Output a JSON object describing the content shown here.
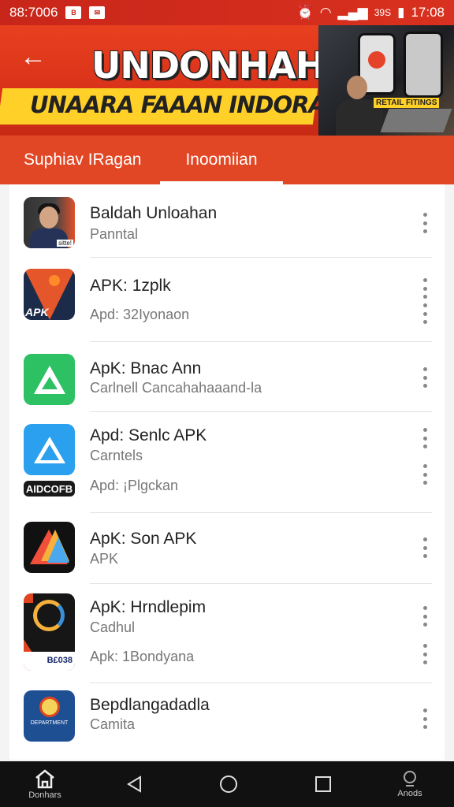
{
  "status_bar": {
    "time_left": "88:7006",
    "battery": "39S",
    "clock": "17:08"
  },
  "header": {
    "back_icon": "back-arrow-icon",
    "banner_title": "UNDONHAHIA",
    "banner_subtitle": "UNAARA FAAAN INDORANEAN!",
    "photo_tag": "RETAIL FITINGS"
  },
  "tabs": [
    {
      "label": "Suphiav IRagan",
      "selected": false
    },
    {
      "label": "Inoomiian",
      "selected": true
    }
  ],
  "apps": [
    {
      "title": "Baldah Unloahan",
      "subtitle": "Panntal",
      "icon": "portrait-icon",
      "icon_tag": "sitte!"
    },
    {
      "title": "APK: 1zplk",
      "subtitle": "Apd: 32Iyonaon",
      "icon": "apk-logo-icon",
      "icon_text": "APK"
    },
    {
      "title": "ApK: Bnac Ann",
      "subtitle": "Carlnell Cancahahaaand-la",
      "icon": "green-triangle-icon"
    },
    {
      "title": "Apd: Senlc APK",
      "subtitle": "Carntels",
      "subtitle2": "Apd: ¡Plgckan",
      "icon": "blue-triangle-icon",
      "pill_label": "AIDCOFB"
    },
    {
      "title": "ApK: Son APK",
      "subtitle": "APK",
      "icon": "folded-triangle-icon"
    },
    {
      "title": "ApK: Hrndlepim",
      "subtitle": "Cadhul",
      "subtitle2": "Apk: 1Bondyana",
      "icon": "poster-icon",
      "icon_text": "B£038"
    },
    {
      "title": "Bepdlangadadla",
      "subtitle": "Camita",
      "icon": "badge-icon",
      "icon_text": "DEPARTMENT"
    }
  ],
  "nav": {
    "home_label": "Donhars",
    "apps_label": "Anods"
  },
  "colors": {
    "accent": "#e24725",
    "banner_yellow": "#ffd028",
    "nav_bg": "#111111"
  }
}
